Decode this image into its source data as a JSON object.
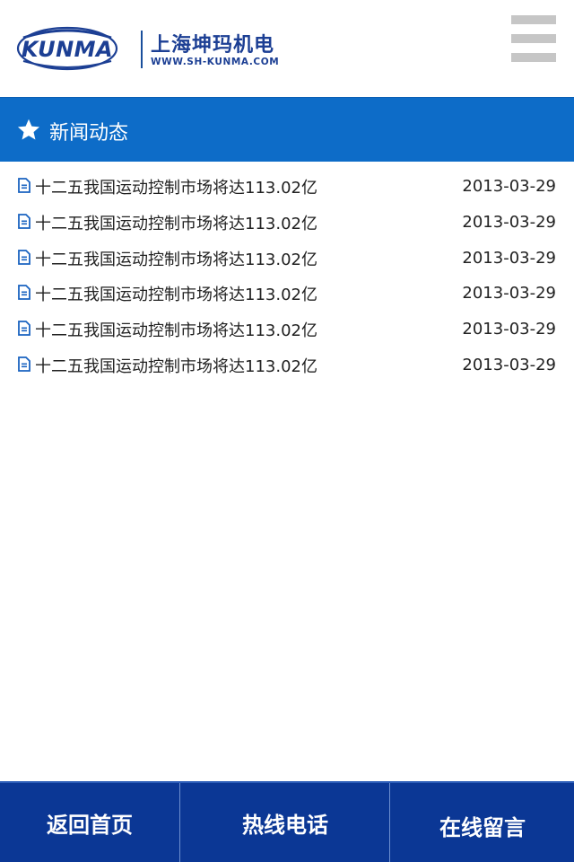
{
  "header": {
    "logo_mark": "KUNMA",
    "logo_cn": "上海坤玛机电",
    "logo_url": "WWW.SH-KUNMA.COM"
  },
  "section": {
    "title": "新闻动态"
  },
  "news": [
    {
      "title": "十二五我国运动控制市场将达113.02亿",
      "date": "2013-03-29"
    },
    {
      "title": "十二五我国运动控制市场将达113.02亿",
      "date": "2013-03-29"
    },
    {
      "title": "十二五我国运动控制市场将达113.02亿",
      "date": "2013-03-29"
    },
    {
      "title": "十二五我国运动控制市场将达113.02亿",
      "date": "2013-03-29"
    },
    {
      "title": "十二五我国运动控制市场将达113.02亿",
      "date": "2013-03-29"
    },
    {
      "title": "十二五我国运动控制市场将达113.02亿",
      "date": "2013-03-29"
    }
  ],
  "footer": {
    "home_label": "返回首页",
    "hotline_label": "热线电话",
    "message_label": "在线留言"
  },
  "colors": {
    "brand_blue": "#1c3f94",
    "section_bar": "#0d6cc8",
    "footer_bar": "#0b3795",
    "doc_icon": "#1a63c0"
  },
  "icons": {
    "menu": "hamburger-icon",
    "section": "star-icon",
    "news_item": "document-icon"
  }
}
